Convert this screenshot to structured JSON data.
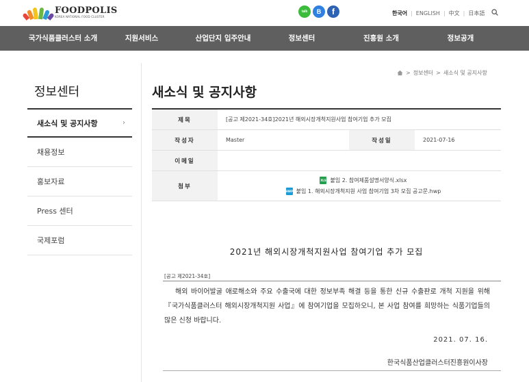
{
  "header": {
    "logo_text": "FOODPOLIS",
    "logo_sub": "KOREA NATIONAL FOOD CLUSTER",
    "social": [
      {
        "name": "kakaotalk",
        "label": "talk"
      },
      {
        "name": "blog",
        "label": "B"
      },
      {
        "name": "facebook",
        "label": "f"
      }
    ],
    "languages": [
      "한국어",
      "ENGLISH",
      "中文",
      "日本語"
    ],
    "active_language": "한국어"
  },
  "nav": {
    "items": [
      "국가식품클러스터 소개",
      "지원서비스",
      "산업단지 입주안내",
      "정보센터",
      "진흥원 소개",
      "정보공개"
    ]
  },
  "sidebar": {
    "title": "정보센터",
    "items": [
      {
        "label": "새소식 및 공지사항",
        "active": true
      },
      {
        "label": "채용정보",
        "active": false
      },
      {
        "label": "홍보자료",
        "active": false
      },
      {
        "label": "Press 센터",
        "active": false
      },
      {
        "label": "국제포럼",
        "active": false
      }
    ],
    "chevron": "›"
  },
  "breadcrumb": {
    "sep": ">",
    "items": [
      "정보센터",
      "새소식 및 공지사항"
    ]
  },
  "page_title": "새소식 및 공지사항",
  "post": {
    "labels": {
      "title": "제목",
      "author": "작성자",
      "date": "작성일",
      "email": "이메일",
      "attachments": "첨부"
    },
    "title": "[공고 제2021-34호]2021년 해외시장개척지원사업 참여기업 추가 모집",
    "author": "Master",
    "date": "2021-07-16",
    "email": "",
    "attachments": [
      {
        "type": "xls",
        "icon_label": "XLS",
        "name": "붙임 2. 참여제품설명서양식.xlsx"
      },
      {
        "type": "hwp",
        "icon_label": "HWP",
        "name": "붙임 1. 해외시장개척지원 사업 참여기업 3차 모집 공고문.hwp"
      }
    ]
  },
  "content": {
    "heading": "2021년 해외시장개척지원사업 참여기업 추가 모집",
    "notice_number": "[공고 제2021-34호]",
    "paragraph": "해외 바이어발굴 애로해소와 주요 수출국에 대한 정보부족 해결 등을 통한 신규 수출판로 개척 지원을 위해 『국가식품클러스터 해외시장개척지원 사업』에 참여기업을 모집하오니, 본 사업 참여를 희망하는 식품기업들의 많은 신청 바랍니다.",
    "date": "2021. 07. 16.",
    "signature": "한국식품산업클러스터진흥원이사장"
  }
}
